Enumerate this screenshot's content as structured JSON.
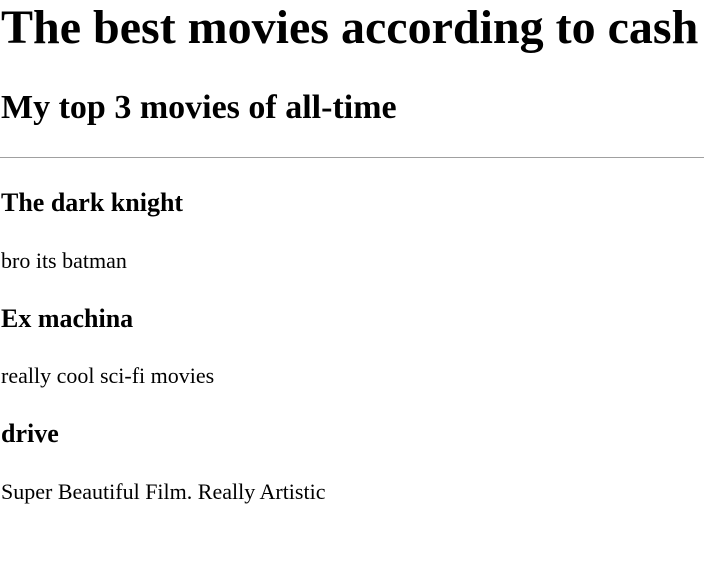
{
  "page": {
    "title": "The best movies according to cash",
    "subtitle": "My top 3 movies of all-time"
  },
  "movies": [
    {
      "title": "The dark knight",
      "description": "bro its batman"
    },
    {
      "title": "Ex machina",
      "description": "really cool sci-fi movies"
    },
    {
      "title": "drive",
      "description": "Super Beautiful Film. Really Artistic"
    }
  ]
}
